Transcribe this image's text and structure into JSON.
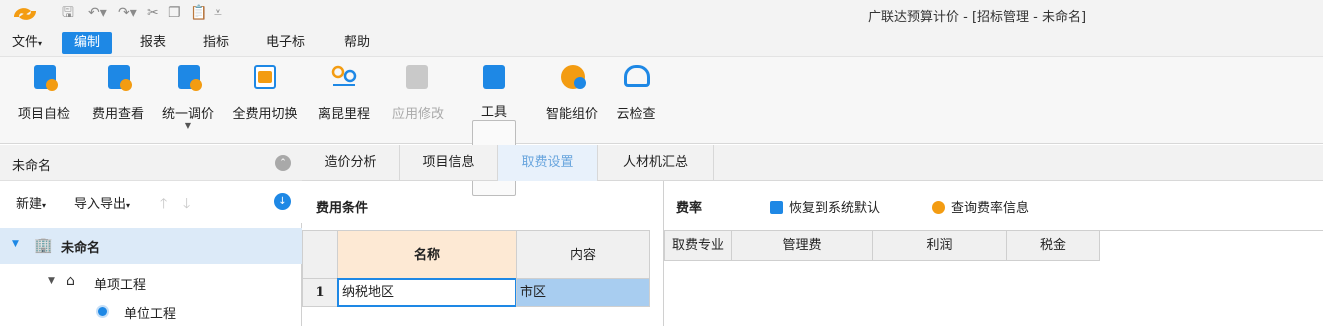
{
  "window": {
    "title": "广联达预算计价 - [招标管理 - 未命名]"
  },
  "quick_access": {
    "icons": [
      "save-icon",
      "undo-icon",
      "redo-icon",
      "cut-icon",
      "copy-icon",
      "paste-icon",
      "customize-icon"
    ]
  },
  "menu": {
    "file": "文件",
    "edit": "编制",
    "report": "报表",
    "indicator": "指标",
    "etender": "电子标",
    "help": "帮助"
  },
  "ribbon": {
    "self_check": "项目自检",
    "fee_view": "费用查看",
    "unified_price": "统一调价",
    "full_fee_switch": "全费用切换",
    "mileage": "离昆里程",
    "apply_modify": "应用修改",
    "tools": "工具",
    "smart_price": "智能组价",
    "cloud_check": "云检查"
  },
  "left_pane": {
    "title": "未命名",
    "new": "新建",
    "import_export": "导入导出",
    "tree": {
      "root": "未命名",
      "single": "单项工程",
      "unit": "单位工程"
    }
  },
  "tabs": [
    "造价分析",
    "项目信息",
    "取费设置",
    "人材机汇总"
  ],
  "fee_conditions": {
    "title": "费用条件",
    "headers": {
      "name": "名称",
      "content": "内容"
    },
    "rows": [
      {
        "num": "1",
        "name": "纳税地区",
        "content": "市区"
      }
    ]
  },
  "fee_rate": {
    "title": "费率",
    "restore": "恢复到系统默认",
    "query": "查询费率信息",
    "headers": [
      "取费专业",
      "管理费",
      "利润",
      "税金"
    ]
  },
  "colors": {
    "accent": "#1e88e5",
    "orange": "#f39c12",
    "selected_row": "#a8cdf0"
  }
}
